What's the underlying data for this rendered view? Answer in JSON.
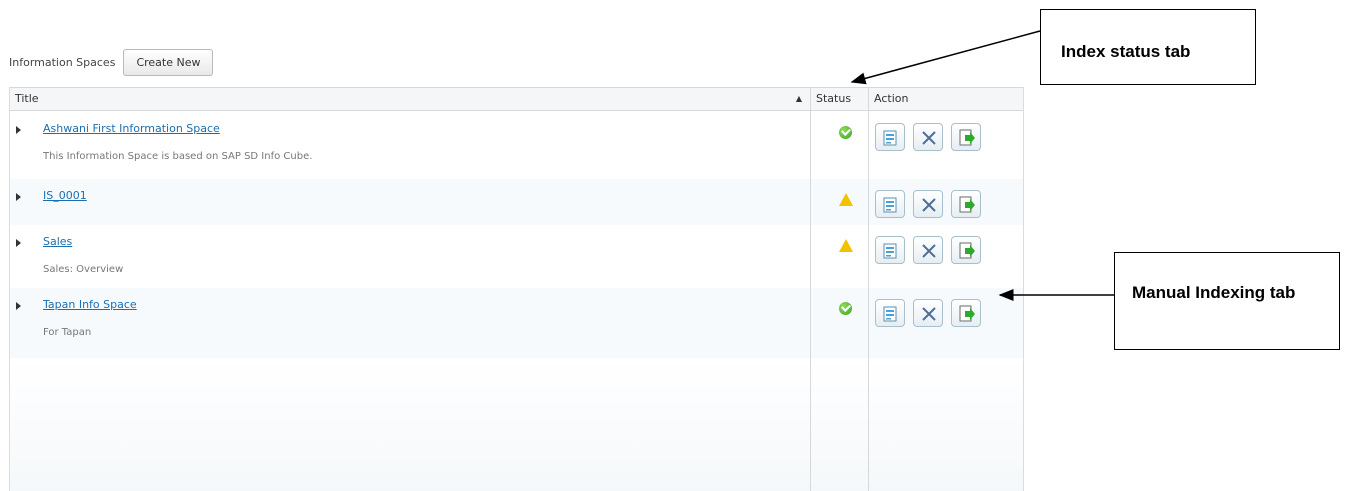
{
  "toolbar": {
    "label": "Information Spaces",
    "create_button": "Create New"
  },
  "grid": {
    "columns": {
      "title": "Title",
      "status": "Status",
      "action": "Action"
    },
    "sort_icon": "sort-ascending-icon",
    "rows": [
      {
        "title": "Ashwani First Information Space",
        "description": "This Information Space is based on SAP SD Info Cube.",
        "status": "ok"
      },
      {
        "title": "IS_0001",
        "description": "",
        "status": "warning"
      },
      {
        "title": "Sales",
        "description": "Sales: Overview",
        "status": "warning"
      },
      {
        "title": "Tapan Info Space",
        "description": "For Tapan",
        "status": "ok"
      }
    ],
    "action_icons": [
      "edit-icon",
      "delete-icon",
      "manual-index-icon"
    ]
  },
  "annotations": {
    "index_status": "Index status tab",
    "manual_indexing": "Manual Indexing tab"
  },
  "colors": {
    "link": "#1a6fb0",
    "status_ok": "#3e9e22",
    "status_warning": "#f2c200",
    "header_bg": "#f4f6f8"
  }
}
